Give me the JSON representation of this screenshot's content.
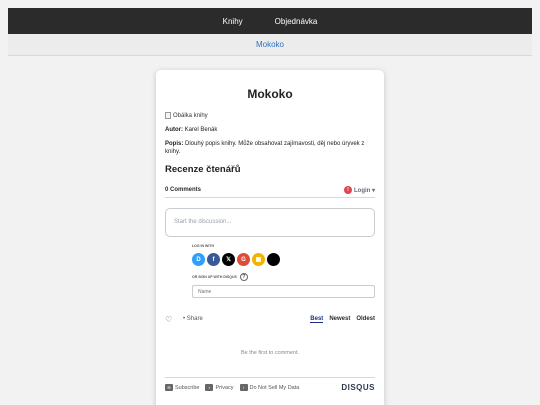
{
  "nav": {
    "items": [
      "Knihy",
      "Objednávka"
    ]
  },
  "subnav": {
    "link": "Mokoko"
  },
  "book": {
    "title": "Mokoko",
    "cover_alt": "Obálka knihy",
    "author_label": "Autor:",
    "author": "Karel Benák",
    "desc_label": "Popis:",
    "description": "Dlouhý popis knihy. Může obsahovat zajímavosti, děj nebo úryvek z knihy."
  },
  "reviews": {
    "heading": "Recenze čtenářů"
  },
  "disqus": {
    "comment_count": "0 Comments",
    "login_label": "Login ▾",
    "discussion_placeholder": "Start the discussion...",
    "login_with": "LOG IN WITH",
    "providers": [
      {
        "name": "disqus",
        "glyph": "D",
        "color": "#2e9fff"
      },
      {
        "name": "facebook",
        "glyph": "f",
        "color": "#3b5998"
      },
      {
        "name": "x",
        "glyph": "𝕏",
        "color": "#000000"
      },
      {
        "name": "google",
        "glyph": "G",
        "color": "#dd4b39"
      },
      {
        "name": "microsoft",
        "glyph": "▦",
        "color": "#f2b400"
      },
      {
        "name": "apple",
        "glyph": "",
        "color": "#000000"
      }
    ],
    "or_sign_up": "OR SIGN UP WITH DISQUS",
    "help_glyph": "?",
    "name_placeholder": "Name",
    "share_label": "• Share",
    "sort": [
      "Best",
      "Newest",
      "Oldest"
    ],
    "empty_text": "Be the first to comment.",
    "footer": {
      "subscribe": "Subscribe",
      "privacy": "Privacy",
      "do_not_sell": "Do Not Sell My Data",
      "brand": "DISQUS"
    }
  }
}
